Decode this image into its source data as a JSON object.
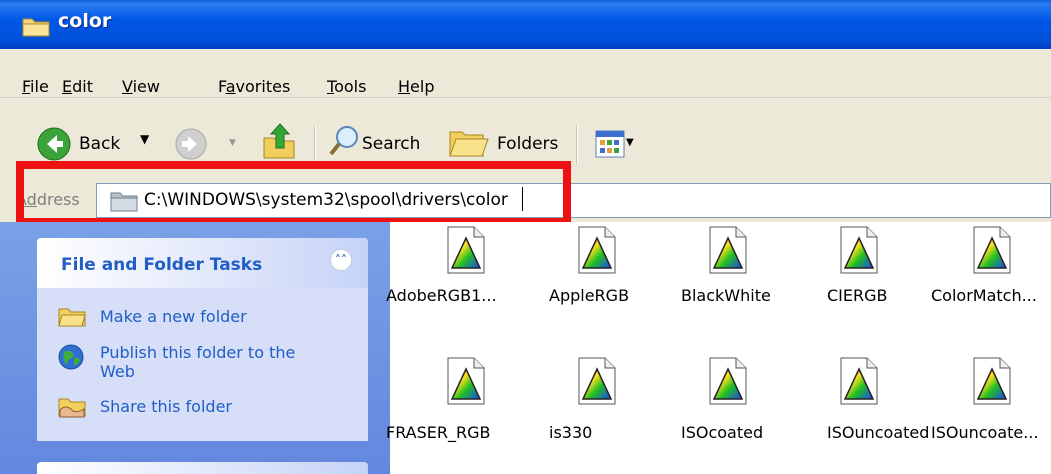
{
  "window": {
    "title": "color"
  },
  "menu": [
    {
      "pre": "",
      "u": "F",
      "post": "ile"
    },
    {
      "pre": "",
      "u": "E",
      "post": "dit"
    },
    {
      "pre": "",
      "u": "V",
      "post": "iew"
    },
    {
      "pre": "F",
      "u": "a",
      "post": "vorites"
    },
    {
      "pre": "",
      "u": "T",
      "post": "ools"
    },
    {
      "pre": "",
      "u": "H",
      "post": "elp"
    }
  ],
  "toolbar": {
    "back_label": "Back",
    "search_label": "Search",
    "folders_label": "Folders"
  },
  "address": {
    "label_pre": "A",
    "label_u": "d",
    "label_post": "dress",
    "value": "C:\\WINDOWS\\system32\\spool\\drivers\\color"
  },
  "tasks": {
    "title": "File and Folder Tasks",
    "items": [
      "Make a new folder",
      "Publish this folder to the",
      "Web",
      "Share this folder"
    ]
  },
  "files": [
    "AdobeRGB1...",
    "AppleRGB",
    "BlackWhite",
    "CIERGB",
    "ColorMatch...",
    "FRASER_RGB",
    "is330",
    "ISOcoated",
    "ISOuncoated",
    "ISOuncoate..."
  ],
  "colors": {
    "titlebar": "#0058e6",
    "highlight": "#ee1111",
    "task_link": "#215dc6",
    "chrome": "#ece9d8"
  }
}
